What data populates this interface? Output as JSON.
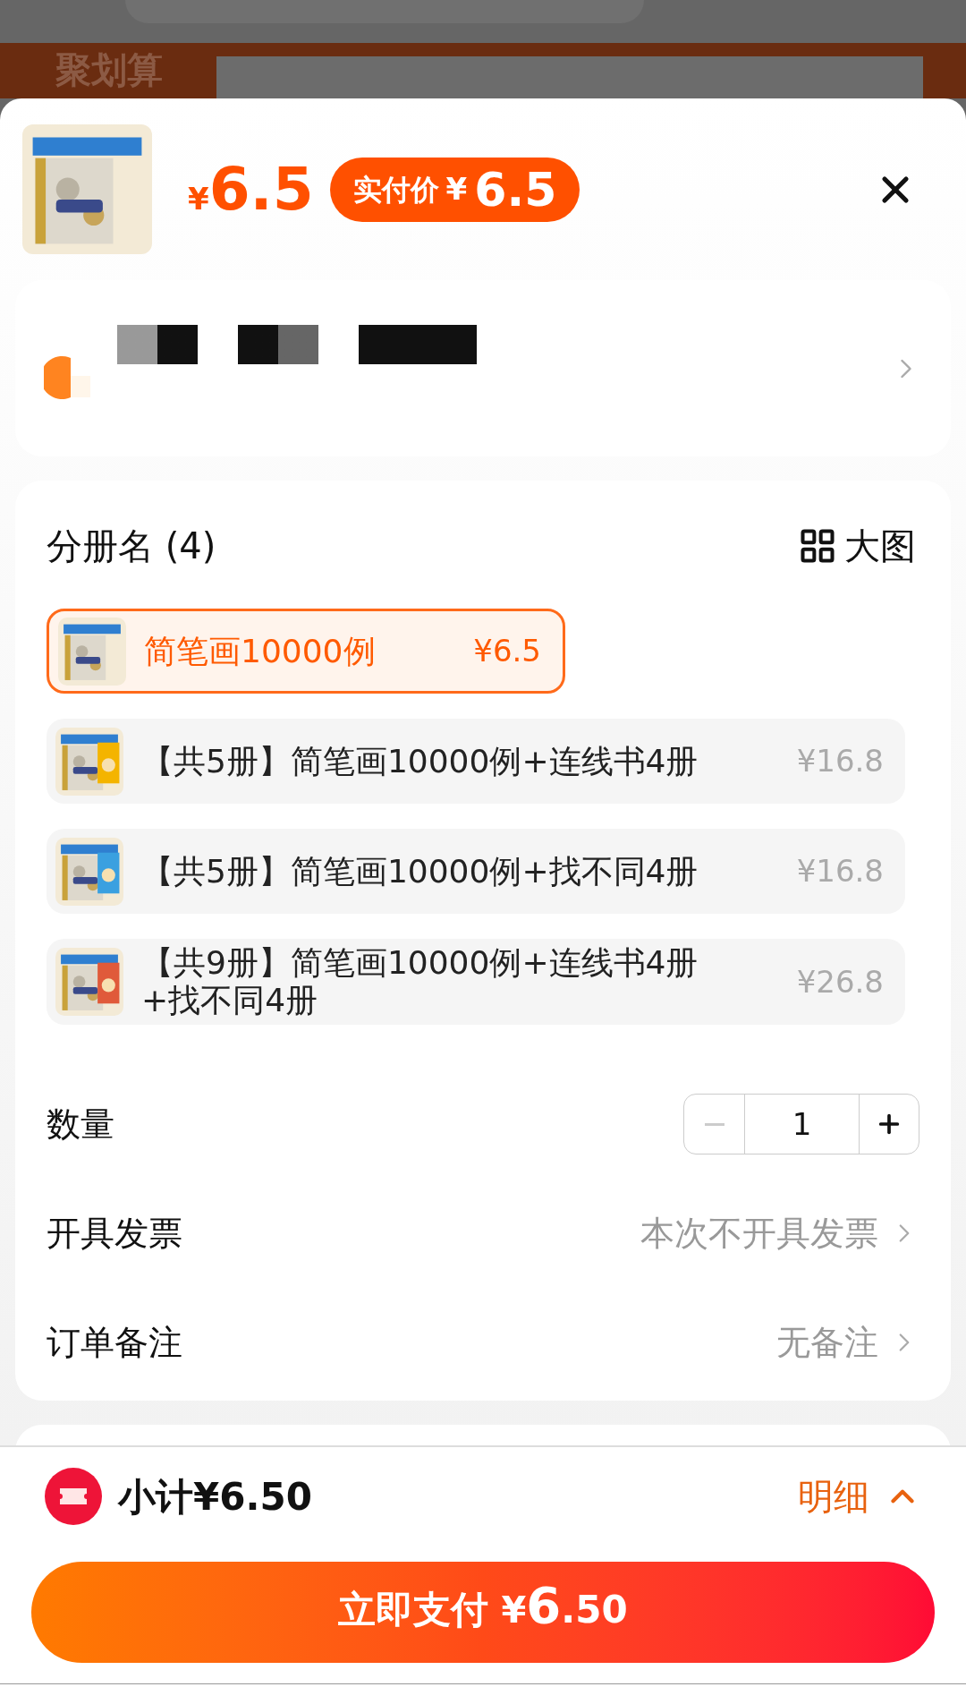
{
  "background": {
    "promo_label": "聚划算"
  },
  "header": {
    "price": {
      "currency": "¥",
      "amount": "6.5"
    },
    "badge": {
      "label": "实付价",
      "currency": "¥",
      "amount": "6.5"
    }
  },
  "variants": {
    "title": "分册名 (4)",
    "view_toggle": "大图",
    "options": [
      {
        "name": "简笔画10000例",
        "price": "¥6.5",
        "selected": true
      },
      {
        "name": "【共5册】简笔画10000例+连线书4册",
        "price": "¥16.8",
        "selected": false
      },
      {
        "name": "【共5册】简笔画10000例+找不同4册",
        "price": "¥16.8",
        "selected": false
      },
      {
        "name": "【共9册】简笔画10000例+连线书4册+找不同4册",
        "price": "¥26.8",
        "selected": false
      }
    ]
  },
  "quantity": {
    "label": "数量",
    "value": "1",
    "decrease_disabled": true
  },
  "invoice": {
    "label": "开具发票",
    "value": "本次不开具发票"
  },
  "note": {
    "label": "订单备注",
    "value": "无备注"
  },
  "footer": {
    "subtotal": "小计¥6.50",
    "details": "明细",
    "pay_button": {
      "label": "立即支付",
      "currency": "¥",
      "integer": "6",
      "decimal": ".50"
    }
  }
}
